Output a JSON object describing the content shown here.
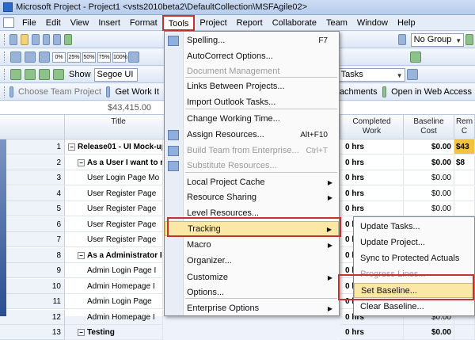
{
  "window": {
    "title": "Microsoft Project - Project1 <vsts2010beta2\\DefaultCollection\\MSFAgile02>"
  },
  "menubar": {
    "items": [
      "File",
      "Edit",
      "View",
      "Insert",
      "Format",
      "Tools",
      "Project",
      "Report",
      "Collaborate",
      "Team",
      "Window",
      "Help"
    ]
  },
  "toolbar1": {
    "group_combo": "No Group"
  },
  "toolbar2": {
    "pct": [
      "0%",
      "25%",
      "50%",
      "75%",
      "100%"
    ]
  },
  "toolbar3": {
    "show_label": "Show",
    "font_combo": "Segoe UI",
    "filter_combo": "All Tasks"
  },
  "teambar": {
    "choose_project": "Choose Team Project",
    "get_work": "Get Work It",
    "attachments": "achments",
    "open_web": "Open in Web Access"
  },
  "editbar": {
    "value": "$43,415.00"
  },
  "grid": {
    "headers": {
      "title": "Title",
      "completed": "Completed\nWork",
      "baseline": "Baseline\nCost",
      "remaining": "Rem\nC"
    },
    "rows": [
      {
        "num": "1",
        "title": "Release01 - UI Mock-up",
        "completed": "0 hrs",
        "cost": "$0.00",
        "rem": "$43",
        "bold": true,
        "level": 0,
        "toggle": "−"
      },
      {
        "num": "2",
        "title": "As a User I want to re",
        "completed": "0 hrs",
        "cost": "$0.00",
        "rem": "$8",
        "bold": true,
        "level": 1,
        "toggle": "−"
      },
      {
        "num": "3",
        "title": "User Login Page Mo",
        "completed": "0 hrs",
        "cost": "$0.00",
        "rem": "",
        "bold": false,
        "level": 2,
        "toggle": ""
      },
      {
        "num": "4",
        "title": "User Register Page",
        "completed": "0 hrs",
        "cost": "$0.00",
        "rem": "",
        "bold": false,
        "level": 2,
        "toggle": ""
      },
      {
        "num": "5",
        "title": "User Register Page",
        "completed": "0 hrs",
        "cost": "$0.00",
        "rem": "",
        "bold": false,
        "level": 2,
        "toggle": ""
      },
      {
        "num": "6",
        "title": "User Register Page",
        "completed": "0 hrs",
        "cost": "$0.00",
        "rem": "",
        "bold": false,
        "level": 2,
        "toggle": ""
      },
      {
        "num": "7",
        "title": "User Register Page",
        "completed": "0 hrs",
        "cost": "$0.00",
        "rem": "",
        "bold": false,
        "level": 2,
        "toggle": ""
      },
      {
        "num": "8",
        "title": "As a Administrator I v",
        "completed": "0 hrs",
        "cost": "$0.00",
        "rem": "",
        "bold": true,
        "level": 1,
        "toggle": "−"
      },
      {
        "num": "9",
        "title": "Admin Login Page I",
        "completed": "0 hrs",
        "cost": "$0.00",
        "rem": "",
        "bold": false,
        "level": 2,
        "toggle": ""
      },
      {
        "num": "10",
        "title": "Admin Homepage I",
        "completed": "0 hrs",
        "cost": "$0.00",
        "rem": "",
        "bold": false,
        "level": 2,
        "toggle": ""
      },
      {
        "num": "11",
        "title": "Admin Login Page",
        "completed": "0 hrs",
        "cost": "$0.00",
        "rem": "",
        "bold": false,
        "level": 2,
        "toggle": ""
      },
      {
        "num": "12",
        "title": "Admin Homepage I",
        "completed": "0 hrs",
        "cost": "$0.00",
        "rem": "",
        "bold": false,
        "level": 2,
        "toggle": ""
      },
      {
        "num": "13",
        "title": "Testing",
        "completed": "0 hrs",
        "cost": "$0.00",
        "rem": "",
        "bold": true,
        "level": 1,
        "toggle": "−"
      }
    ]
  },
  "tools_menu": [
    {
      "label": "Spelling...",
      "shortcut": "F7",
      "disabled": false,
      "icon": "spelling-icon"
    },
    {
      "label": "AutoCorrect Options...",
      "disabled": false
    },
    {
      "label": "Document Management",
      "disabled": true
    },
    {
      "label": "Links Between Projects...",
      "disabled": false
    },
    {
      "label": "Import Outlook Tasks...",
      "disabled": false
    },
    {
      "label": "Change Working Time...",
      "disabled": false
    },
    {
      "label": "Assign Resources...",
      "shortcut": "Alt+F10",
      "disabled": false,
      "icon": "assign-resources-icon"
    },
    {
      "label": "Build Team from Enterprise...",
      "shortcut": "Ctrl+T",
      "disabled": true,
      "icon": "build-team-icon"
    },
    {
      "label": "Substitute Resources...",
      "disabled": true,
      "icon": "substitute-icon"
    },
    {
      "label": "Local Project Cache",
      "disabled": false,
      "submenu": true
    },
    {
      "label": "Resource Sharing",
      "disabled": false,
      "submenu": true
    },
    {
      "label": "Level Resources...",
      "disabled": false
    },
    {
      "label": "Tracking",
      "disabled": false,
      "submenu": true,
      "highlighted": true
    },
    {
      "label": "Macro",
      "disabled": false,
      "submenu": true
    },
    {
      "label": "Organizer...",
      "disabled": false
    },
    {
      "label": "Customize",
      "disabled": false,
      "submenu": true
    },
    {
      "label": "Options...",
      "disabled": false
    },
    {
      "label": "Enterprise Options",
      "disabled": false,
      "submenu": true
    }
  ],
  "tracking_submenu": [
    {
      "label": "Update Tasks...",
      "disabled": false
    },
    {
      "label": "Update Project...",
      "disabled": false
    },
    {
      "label": "Sync to Protected Actuals",
      "disabled": false
    },
    {
      "label": "Progress Lines...",
      "disabled": true
    },
    {
      "label": "Set Baseline...",
      "disabled": false,
      "highlighted": true
    },
    {
      "label": "Clear Baseline...",
      "disabled": false
    }
  ]
}
